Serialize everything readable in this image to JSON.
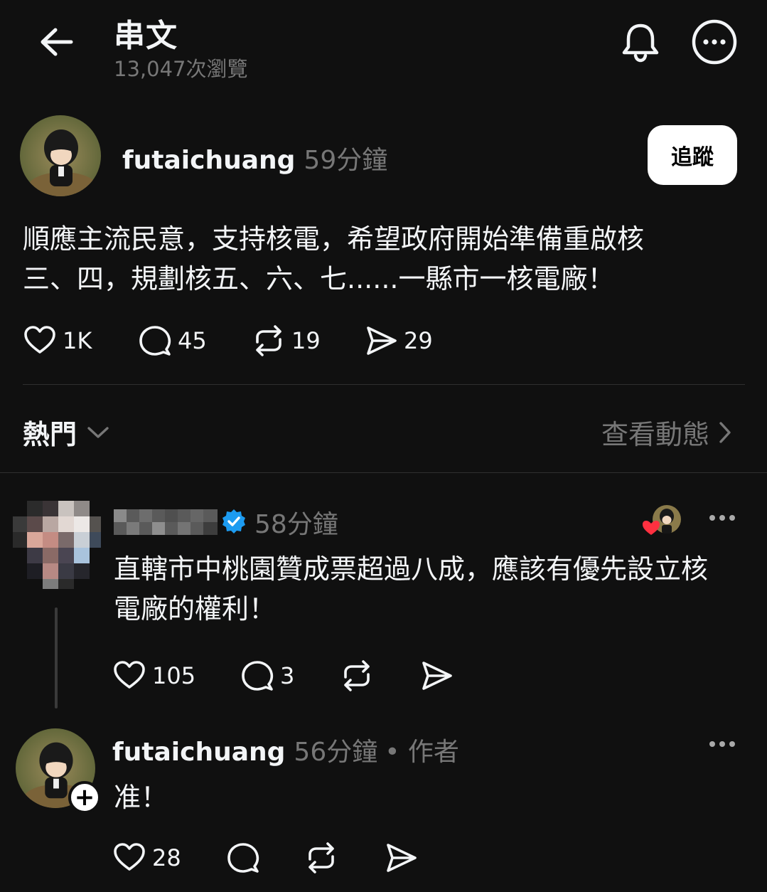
{
  "header": {
    "title": "串文",
    "views": "13,047次瀏覽",
    "back_icon": "arrow-left-icon",
    "notify_icon": "bell-icon",
    "menu_icon": "more-circle-icon"
  },
  "post": {
    "username": "futaichuang",
    "time": "59分鐘",
    "follow_label": "追蹤",
    "text_line1": "順應主流民意，支持核電，希望政府開始準備重啟核",
    "text_line2": "三、四，規劃核五、六、七......一縣市一核電廠！",
    "likes": "1K",
    "replies": "45",
    "reposts": "19",
    "shares": "29"
  },
  "sort_bar": {
    "sort_label": "熱門",
    "activity_label": "查看動態"
  },
  "comments": [
    {
      "time": "58分鐘",
      "text_line1": "直轄市中桃園贊成票超過八成，應該有優先設立核",
      "text_line2": "電廠的權利！",
      "likes": "105",
      "replies": "3"
    },
    {
      "username": "futaichuang",
      "time": "56分鐘",
      "author_tag": "• 作者",
      "text": "准！",
      "likes": "28"
    }
  ],
  "colors": {
    "background": "#101010",
    "text": "#f3f5f7",
    "muted": "#777777",
    "verified": "#1d9bf0",
    "heart": "#ff3040"
  }
}
